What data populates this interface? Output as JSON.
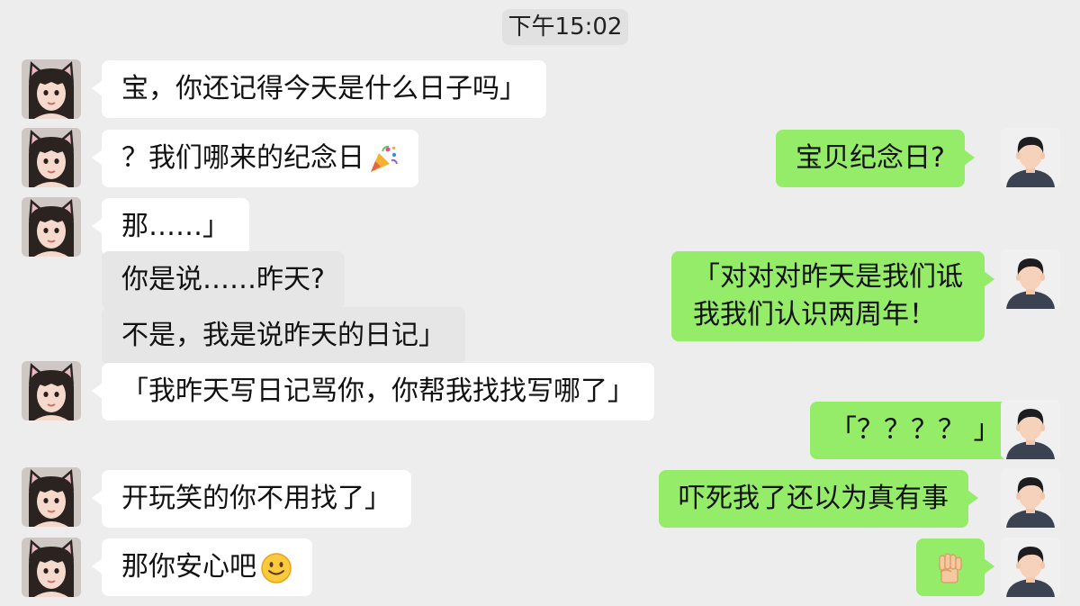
{
  "chat": {
    "timestamp": "下午15:02",
    "messages": [
      {
        "side": "in",
        "text": "宝，你还记得今天是什么日子吗」"
      },
      {
        "side": "in",
        "text": "？我们哪来的纪念日",
        "emoji": "party-popper-icon"
      },
      {
        "side": "out",
        "text": "宝贝纪念日?"
      },
      {
        "side": "in",
        "text": "那……」"
      },
      {
        "side": "in",
        "text": "你是说……昨天?"
      },
      {
        "side": "out",
        "lines": [
          "「对对对昨天是我们诋",
          "我我们认识两周年！"
        ]
      },
      {
        "side": "in",
        "text": "不是，我是说昨天的日记」"
      },
      {
        "side": "in",
        "text": "「我昨天写日记骂你，你帮我找找写哪了」"
      },
      {
        "side": "out",
        "text": "「？？？？ 」"
      },
      {
        "side": "in",
        "text": "开玩笑的你不用找了」"
      },
      {
        "side": "out",
        "text": "吓死我了还以为真有事"
      },
      {
        "side": "in",
        "text": "那你安心吧",
        "emoji": "slightly-smiling-face-icon"
      },
      {
        "side": "out",
        "emoji": "raised-fist-icon"
      }
    ]
  },
  "colors": {
    "background": "#ededed",
    "incoming_bubble": "#ffffff",
    "outgoing_bubble": "#95ec69"
  }
}
